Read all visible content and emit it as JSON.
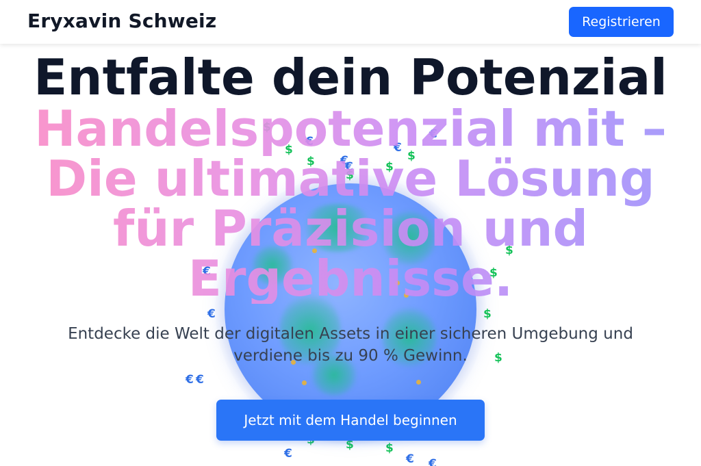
{
  "header": {
    "brand": "Eryxavin Schweiz",
    "register_label": "Registrieren"
  },
  "hero": {
    "title": "Entfalte dein Potenzial",
    "gradient_title": "Handelspotenzial mit – Die ultimative Lösung für Präzision und Ergebnisse.",
    "subtitle": "Entdecke die Welt der digitalen Assets in einer sicheren Umgebung und verdiene bis zu 90 % Gewinn.",
    "cta_label": "Jetzt mit dem Handel beginnen"
  },
  "decor": {
    "dollar_symbol": "$",
    "euro_symbol": "€",
    "globe_icon": "globe-icon"
  },
  "colors": {
    "primary_button": "#1966ff",
    "cta_button": "#2a75f7",
    "dollar_color": "#16c25a",
    "euro_color": "#2f6fe6",
    "gradient_start": "#f98bc7",
    "gradient_end": "#9f92fb"
  }
}
